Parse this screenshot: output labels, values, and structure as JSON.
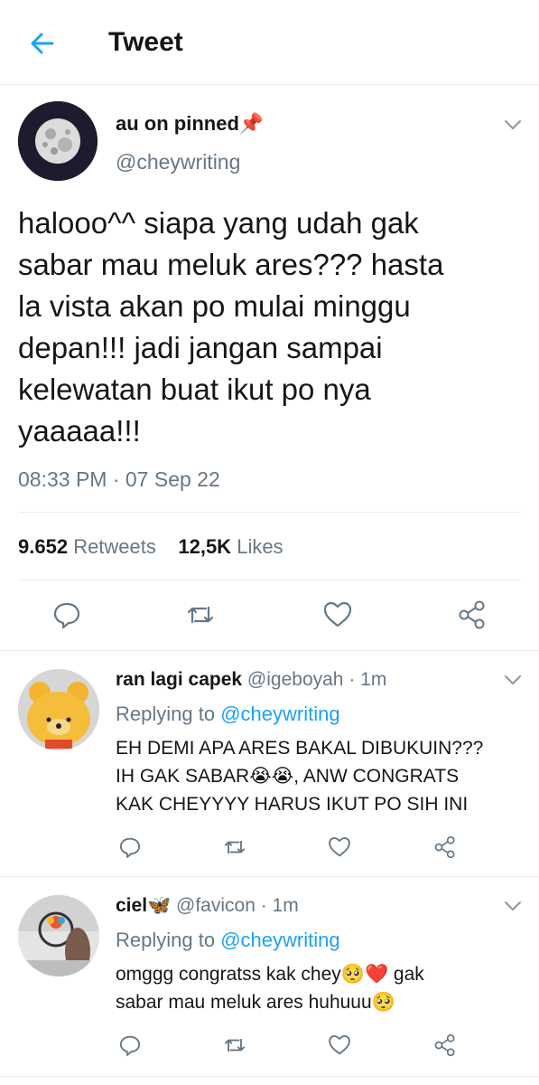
{
  "header": {
    "title": "Tweet"
  },
  "tweet": {
    "name": "au on pinned📌",
    "handle": "@cheywriting",
    "text_lines": [
      "halooo^^ siapa yang udah gak",
      "sabar mau meluk ares??? hasta",
      "la vista akan po mulai minggu",
      "depan!!! jadi jangan sampai",
      "kelewatan buat ikut po nya",
      "yaaaaa!!!"
    ],
    "timestamp": "08:33 PM · 07 Sep 22",
    "retweets_count": "9.652",
    "retweets_label": "Retweets",
    "likes_count": "12,5K",
    "likes_label": "Likes"
  },
  "replies": [
    {
      "name": "ran lagi capek",
      "handle": "@igeboyah · 1m",
      "replying_prefix": "Replying to",
      "replying_handle": "@cheywriting",
      "text_lines": [
        "EH DEMI APA ARES BAKAL DIBUKUIN???",
        "IH GAK SABAR😭😭, ANW CONGRATS",
        "KAK CHEYYYY HARUS IKUT PO SIH INI"
      ]
    },
    {
      "name": "ciel🦋",
      "handle": "@favicon · 1m",
      "replying_prefix": "Replying to",
      "replying_handle": "@cheywriting",
      "text_lines": [
        "omggg congratss kak chey🥺❤️ gak",
        "sabar mau meluk ares huhuuu🥺"
      ]
    }
  ],
  "colors": {
    "accent": "#1da1f2",
    "secondary_text": "#657786",
    "divider": "#e6ecf0"
  }
}
